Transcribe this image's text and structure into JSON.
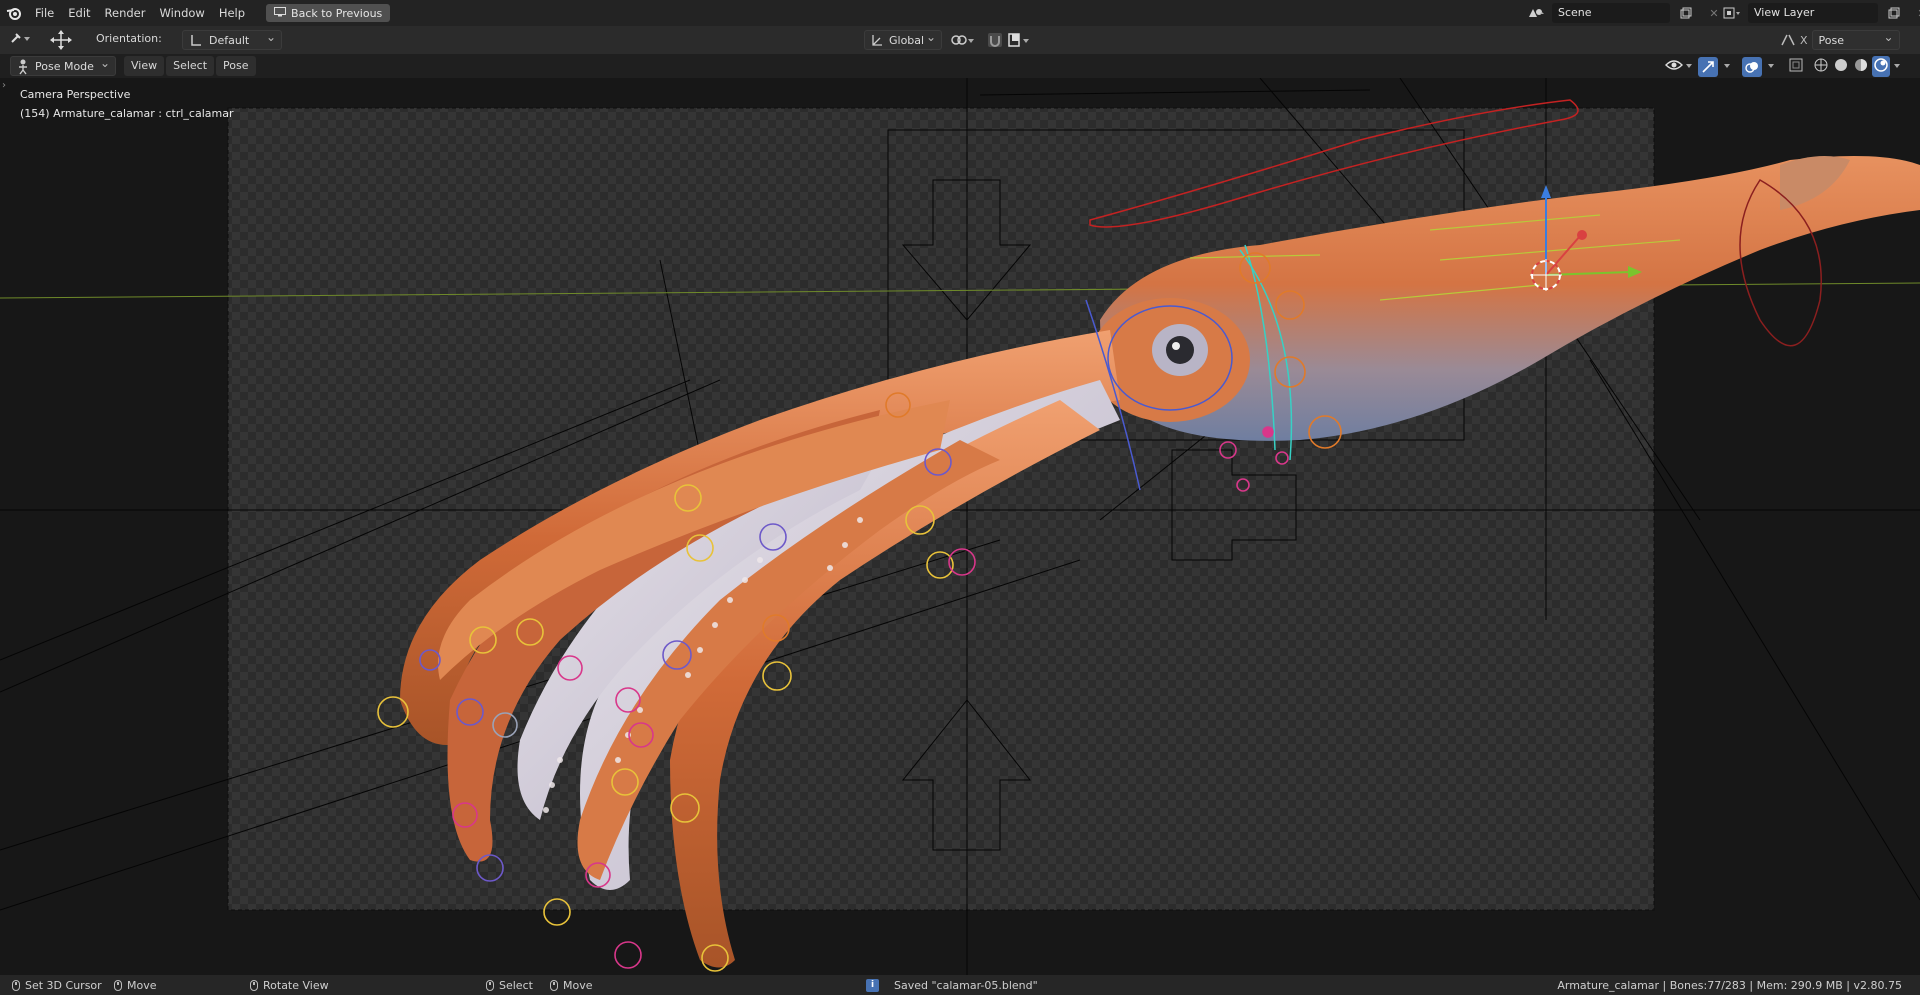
{
  "menu": {
    "items": [
      "File",
      "Edit",
      "Render",
      "Window",
      "Help"
    ],
    "back_button": "Back to Previous"
  },
  "scene": {
    "name": "Scene"
  },
  "view_layer": {
    "name": "View Layer"
  },
  "tool_header": {
    "orientation_label": "Orientation:",
    "orientation_value": "Default",
    "transform_space": "Global",
    "pose_options": "Pose Options"
  },
  "viewport_header": {
    "mode": "Pose Mode",
    "menus": [
      "View",
      "Select",
      "Pose"
    ]
  },
  "viewport": {
    "camera_label": "Camera Perspective",
    "object_label": "(154) Armature_calamar : ctrl_calamar"
  },
  "status": {
    "set_cursor": "Set 3D Cursor",
    "move1": "Move",
    "rotate_view": "Rotate View",
    "select": "Select",
    "move2": "Move",
    "saved": "Saved \"calamar-05.blend\"",
    "stats": "Armature_calamar | Bones:77/283 | Mem: 290.9 MB | v2.80.75"
  },
  "colors": {
    "accent": "#4772b3",
    "squid_orange": "#d8733f",
    "bone_yellow": "#e8c23a",
    "bone_orange": "#e07a2a",
    "bone_magenta": "#d8378a",
    "bone_purple": "#6d59c9"
  }
}
